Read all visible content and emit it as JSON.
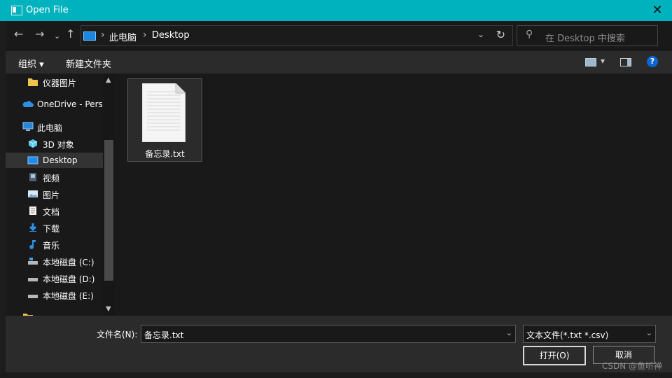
{
  "window": {
    "title": "Open File"
  },
  "navigation": {
    "breadcrumbs": [
      "此电脑",
      "Desktop"
    ],
    "search_placeholder": "在 Desktop 中搜索"
  },
  "toolbar": {
    "organize": "组织",
    "new_folder": "新建文件夹"
  },
  "sidebar": {
    "items": [
      {
        "label": "仪器图片",
        "icon": "folder-icon"
      },
      {
        "label": "OneDrive - Perso",
        "icon": "onedrive-icon"
      },
      {
        "label": "此电脑",
        "icon": "this-pc-icon"
      },
      {
        "label": "3D 对象",
        "icon": "3d-objects-icon"
      },
      {
        "label": "Desktop",
        "icon": "desktop-icon"
      },
      {
        "label": "视频",
        "icon": "video-icon"
      },
      {
        "label": "图片",
        "icon": "pictures-icon"
      },
      {
        "label": "文档",
        "icon": "documents-icon"
      },
      {
        "label": "下载",
        "icon": "download-icon"
      },
      {
        "label": "音乐",
        "icon": "music-icon"
      },
      {
        "label": "本地磁盘 (C:)",
        "icon": "drive-icon"
      },
      {
        "label": "本地磁盘 (D:)",
        "icon": "drive-icon"
      },
      {
        "label": "本地磁盘 (E:)",
        "icon": "drive-icon"
      }
    ]
  },
  "content": {
    "files": [
      {
        "name": "备忘录.txt",
        "icon": "text-file-icon"
      }
    ]
  },
  "footer": {
    "filename_label": "文件名(N):",
    "filename_value": "备忘录.txt",
    "filetype_value": "文本文件(*.txt *.csv)",
    "open_button": "打开(O)",
    "cancel_button": "取消",
    "watermark": "CSDN @鱼听禅"
  },
  "colors": {
    "titlebar": "#00b2bd",
    "selection": "#333333",
    "accent": "#0a66d6"
  }
}
